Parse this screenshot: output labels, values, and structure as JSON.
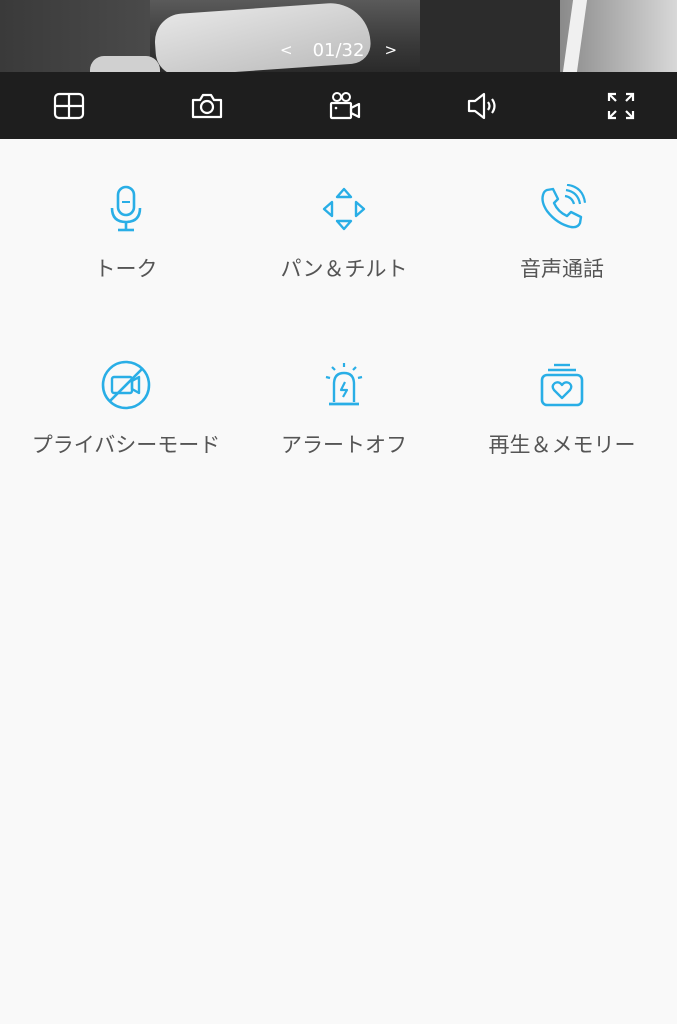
{
  "viewer": {
    "pager": {
      "prev": "<",
      "text": "01/32",
      "next": ">"
    }
  },
  "toolbar": {
    "items": [
      {
        "icon": "split-view-icon"
      },
      {
        "icon": "camera-snapshot-icon"
      },
      {
        "icon": "video-record-icon"
      },
      {
        "icon": "speaker-icon"
      },
      {
        "icon": "fullscreen-icon"
      }
    ]
  },
  "features": {
    "accent": "#29aee6",
    "items": [
      {
        "label": "トーク",
        "icon": "microphone-icon"
      },
      {
        "label": "パン＆チルト",
        "icon": "pan-tilt-icon"
      },
      {
        "label": "音声通話",
        "icon": "phone-call-icon"
      },
      {
        "label": "プライバシーモード",
        "icon": "privacy-mode-icon"
      },
      {
        "label": "アラートオフ",
        "icon": "alarm-light-icon"
      },
      {
        "label": "再生＆メモリー",
        "icon": "playback-memory-icon"
      }
    ]
  }
}
